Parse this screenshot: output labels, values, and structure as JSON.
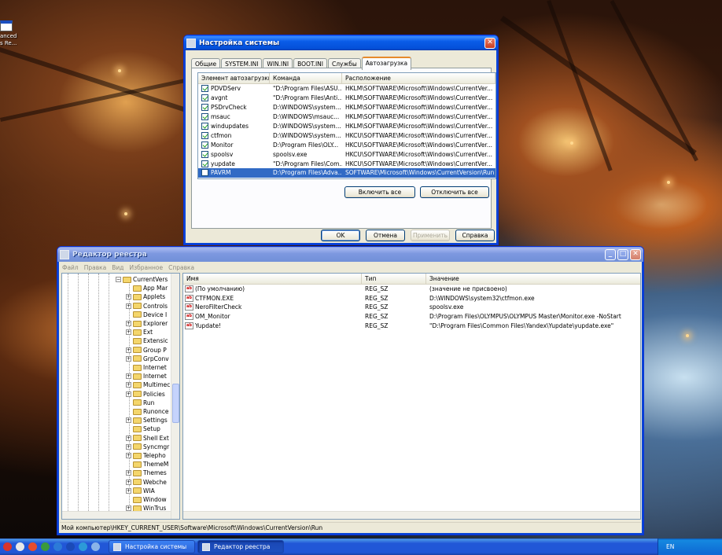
{
  "desktop": {
    "icon_label": "anced\ns Re..."
  },
  "syscfg": {
    "title": "Настройка системы",
    "tabs": [
      "Общие",
      "SYSTEM.INI",
      "WIN.INI",
      "BOOT.INI",
      "Службы",
      "Автозагрузка"
    ],
    "columns": [
      "Элемент автозагрузки",
      "Команда",
      "Расположение"
    ],
    "rows": [
      {
        "name": "PDVDServ",
        "command": "\"D:\\Program Files\\ASU...",
        "location": "HKLM\\SOFTWARE\\Microsoft\\Windows\\CurrentVer...",
        "checked": true
      },
      {
        "name": "avgnt",
        "command": "\"D:\\Program Files\\Anti...",
        "location": "HKLM\\SOFTWARE\\Microsoft\\Windows\\CurrentVer...",
        "checked": true
      },
      {
        "name": "PSDrvCheck",
        "command": "D:\\WINDOWS\\system...",
        "location": "HKLM\\SOFTWARE\\Microsoft\\Windows\\CurrentVer...",
        "checked": true
      },
      {
        "name": "msauc",
        "command": "D:\\WINDOWS\\msauc...",
        "location": "HKLM\\SOFTWARE\\Microsoft\\Windows\\CurrentVer...",
        "checked": true
      },
      {
        "name": "windupdates",
        "command": "D:\\WINDOWS\\system...",
        "location": "HKLM\\SOFTWARE\\Microsoft\\Windows\\CurrentVer...",
        "checked": true
      },
      {
        "name": "ctfmon",
        "command": "D:\\WINDOWS\\system...",
        "location": "HKCU\\SOFTWARE\\Microsoft\\Windows\\CurrentVer...",
        "checked": true
      },
      {
        "name": "Monitor",
        "command": "D:\\Program Files\\OLY...",
        "location": "HKCU\\SOFTWARE\\Microsoft\\Windows\\CurrentVer...",
        "checked": true
      },
      {
        "name": "spoolsv",
        "command": "spoolsv.exe",
        "location": "HKCU\\SOFTWARE\\Microsoft\\Windows\\CurrentVer...",
        "checked": true
      },
      {
        "name": "yupdate",
        "command": "\"D:\\Program Files\\Com...",
        "location": "HKCU\\SOFTWARE\\Microsoft\\Windows\\CurrentVer...",
        "checked": true
      },
      {
        "name": "PAVRM",
        "command": "D:\\Program Files\\Adva...",
        "location": "SOFTWARE\\Microsoft\\Windows\\CurrentVersion\\Run",
        "checked": false,
        "selected": true
      }
    ],
    "enable_all": "Включить все",
    "disable_all": "Отключить все",
    "ok": "OK",
    "cancel": "Отмена",
    "apply": "Применить",
    "help": "Справка"
  },
  "regedit": {
    "title": "Редактор реестра",
    "menu": [
      "Файл",
      "Правка",
      "Вид",
      "Избранное",
      "Справка"
    ],
    "tree": {
      "parent": "CurrentVers",
      "children": [
        {
          "label": "App Mar",
          "expandable": false
        },
        {
          "label": "Applets",
          "expandable": true
        },
        {
          "label": "Controls",
          "expandable": true
        },
        {
          "label": "Device I",
          "expandable": false
        },
        {
          "label": "Explorer",
          "expandable": true
        },
        {
          "label": "Ext",
          "expandable": true
        },
        {
          "label": "Extensic",
          "expandable": false
        },
        {
          "label": "Group P",
          "expandable": true
        },
        {
          "label": "GrpConv",
          "expandable": true
        },
        {
          "label": "Internet",
          "expandable": false
        },
        {
          "label": "Internet",
          "expandable": true
        },
        {
          "label": "Multimec",
          "expandable": true
        },
        {
          "label": "Policies",
          "expandable": true
        },
        {
          "label": "Run",
          "expandable": false,
          "open": true
        },
        {
          "label": "Runonce",
          "expandable": false
        },
        {
          "label": "Settings",
          "expandable": true
        },
        {
          "label": "Setup",
          "expandable": false
        },
        {
          "label": "Shell Ext",
          "expandable": true
        },
        {
          "label": "Syncmgr",
          "expandable": true
        },
        {
          "label": "Telepho",
          "expandable": true
        },
        {
          "label": "ThemeM",
          "expandable": false
        },
        {
          "label": "Themes",
          "expandable": true
        },
        {
          "label": "Webche",
          "expandable": true
        },
        {
          "label": "WIA",
          "expandable": true
        },
        {
          "label": "Window",
          "expandable": false
        },
        {
          "label": "WinTrus",
          "expandable": true
        }
      ]
    },
    "columns": [
      "Имя",
      "Тип",
      "Значение"
    ],
    "values": [
      {
        "name": "(По умолчанию)",
        "type": "REG_SZ",
        "data": "(значение не присвоено)"
      },
      {
        "name": "CTFMON.EXE",
        "type": "REG_SZ",
        "data": "D:\\WINDOWS\\system32\\ctfmon.exe"
      },
      {
        "name": "NeroFilterCheck",
        "type": "REG_SZ",
        "data": "spoolsv.exe"
      },
      {
        "name": "OM_Monitor",
        "type": "REG_SZ",
        "data": "D:\\Program Files\\OLYMPUS\\OLYMPUS Master\\Monitor.exe -NoStart"
      },
      {
        "name": "Yupdate!",
        "type": "REG_SZ",
        "data": "\"D:\\Program Files\\Common Files\\Yandex\\Yupdate\\yupdate.exe\""
      }
    ],
    "status": "Мой компьютер\\HKEY_CURRENT_USER\\Software\\Microsoft\\Windows\\CurrentVersion\\Run",
    "icon_glyph": "ab"
  },
  "taskbar": {
    "tasks": [
      "Настройка системы",
      "Редактор реестра"
    ],
    "lang": "EN",
    "quick_launch_colors": [
      "#d8342c",
      "#e8e8e8",
      "#e84c2c",
      "#3a9a3a",
      "#2c7ad8",
      "#1a4ab8",
      "#2c9ad8",
      "#8ab4e8"
    ]
  }
}
